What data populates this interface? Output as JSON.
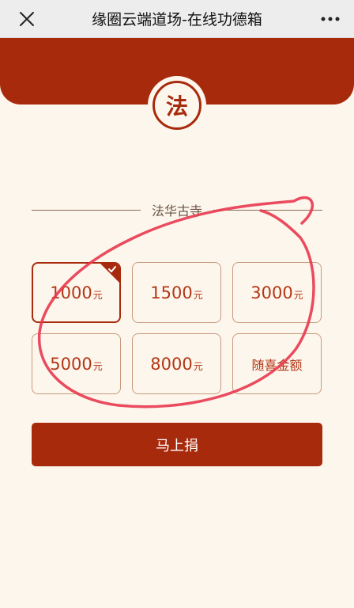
{
  "header": {
    "title": "缘圈云端道场-在线功德箱",
    "close_icon": "close-icon",
    "more_icon": "more-dots-icon"
  },
  "emblem": {
    "char": "法"
  },
  "temple": {
    "name": "法华古寺"
  },
  "amounts": [
    {
      "value": "1000",
      "unit": "元",
      "selected": true
    },
    {
      "value": "1500",
      "unit": "元",
      "selected": false
    },
    {
      "value": "3000",
      "unit": "元",
      "selected": false
    },
    {
      "value": "5000",
      "unit": "元",
      "selected": false
    },
    {
      "value": "8000",
      "unit": "元",
      "selected": false
    }
  ],
  "custom_amount_label": "随喜金额",
  "donate_button_label": "马上捐",
  "colors": {
    "primary": "#a82a0d",
    "background": "#fdf6ec",
    "annotation": "#e8384f"
  }
}
